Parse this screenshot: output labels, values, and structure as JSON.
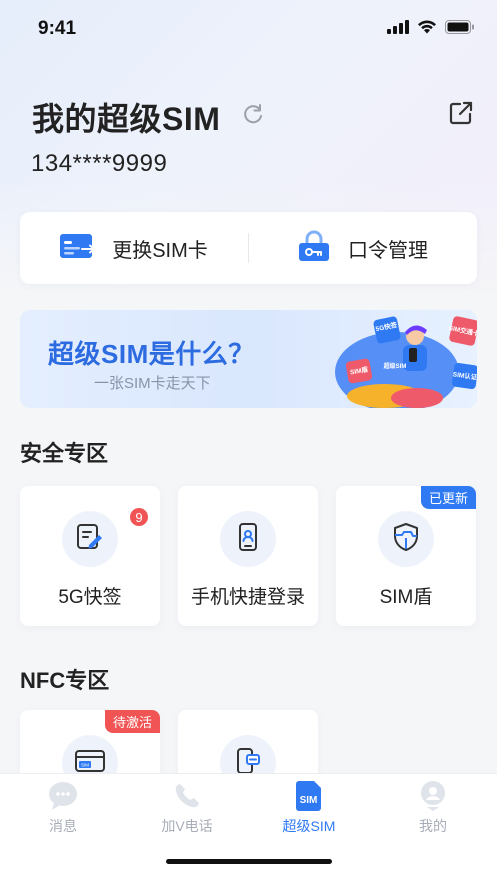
{
  "status_bar": {
    "time": "9:41"
  },
  "header": {
    "title": "我的超级SIM",
    "phone": "134****9999"
  },
  "actions": [
    {
      "label": "更换SIM卡",
      "icon": "sim-card-icon"
    },
    {
      "label": "口令管理",
      "icon": "lock-key-icon"
    }
  ],
  "banner": {
    "title": "超级SIM是什么？",
    "subtitle": "一张SIM卡走天下",
    "art_labels": [
      "5G快签",
      "SIM交通卡",
      "SIM盾",
      "SIM认证",
      "超级SIM"
    ]
  },
  "security_section": {
    "title": "安全专区",
    "tiles": [
      {
        "label": "5G快签",
        "icon": "sign-pen-icon",
        "badge_count": "9"
      },
      {
        "label": "手机快捷登录",
        "icon": "phone-login-icon"
      },
      {
        "label": "SIM盾",
        "icon": "shield-icon",
        "tag": "已更新"
      }
    ]
  },
  "nfc_section": {
    "title": "NFC专区",
    "tiles": [
      {
        "icon": "nfc-card-icon",
        "tag": "待激活",
        "card_text": "SIM"
      },
      {
        "icon": "nfc-phone-icon"
      }
    ]
  },
  "bottom_nav": {
    "items": [
      {
        "label": "消息",
        "icon": "message-icon",
        "active": false
      },
      {
        "label": "加V电话",
        "icon": "phone-icon",
        "active": false
      },
      {
        "label": "超级SIM",
        "icon": "sim-icon",
        "active": true,
        "icon_text": "SIM"
      },
      {
        "label": "我的",
        "icon": "profile-icon",
        "active": false
      }
    ]
  },
  "colors": {
    "accent": "#2f7af3",
    "badge_red": "#f05454",
    "tag_blue": "#2f7af3",
    "tag_red": "#f05454"
  }
}
